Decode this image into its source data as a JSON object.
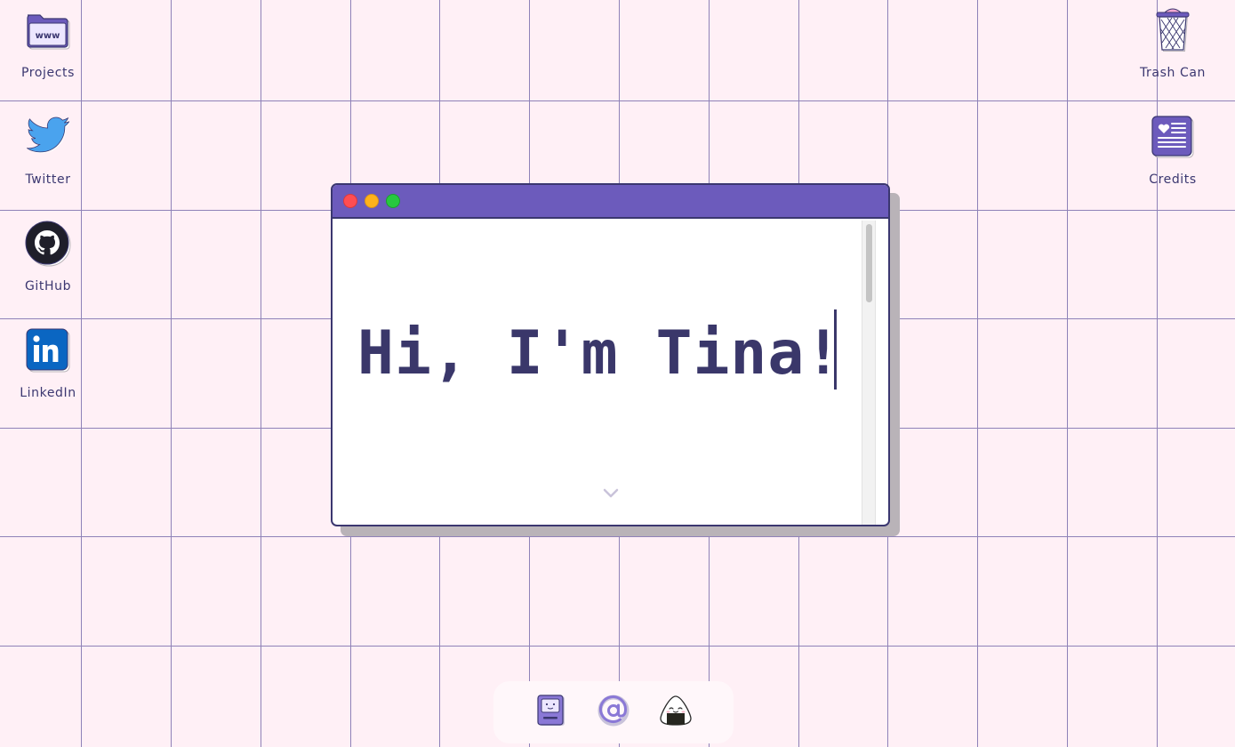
{
  "desktop": {
    "left_icons": [
      {
        "label": "Projects",
        "icon": "www-folder-icon"
      },
      {
        "label": "Twitter",
        "icon": "twitter-bird-icon"
      },
      {
        "label": "GitHub",
        "icon": "github-octocat-icon"
      },
      {
        "label": "LinkedIn",
        "icon": "linkedin-icon"
      }
    ],
    "right_icons": [
      {
        "label": "Trash Can",
        "icon": "trash-can-icon"
      },
      {
        "label": "Credits",
        "icon": "credits-document-icon"
      }
    ]
  },
  "window": {
    "heading": "Hi, I'm Tina!",
    "controls": [
      "close",
      "minimize",
      "maximize"
    ]
  },
  "dock": {
    "items": [
      {
        "icon": "computer-icon"
      },
      {
        "icon": "email-at-icon"
      },
      {
        "icon": "onigiri-icon"
      }
    ]
  },
  "colors": {
    "background": "#fff0f6",
    "grid": "#8f82b8",
    "accent": "#6c5bbc",
    "text": "#3b3770"
  }
}
